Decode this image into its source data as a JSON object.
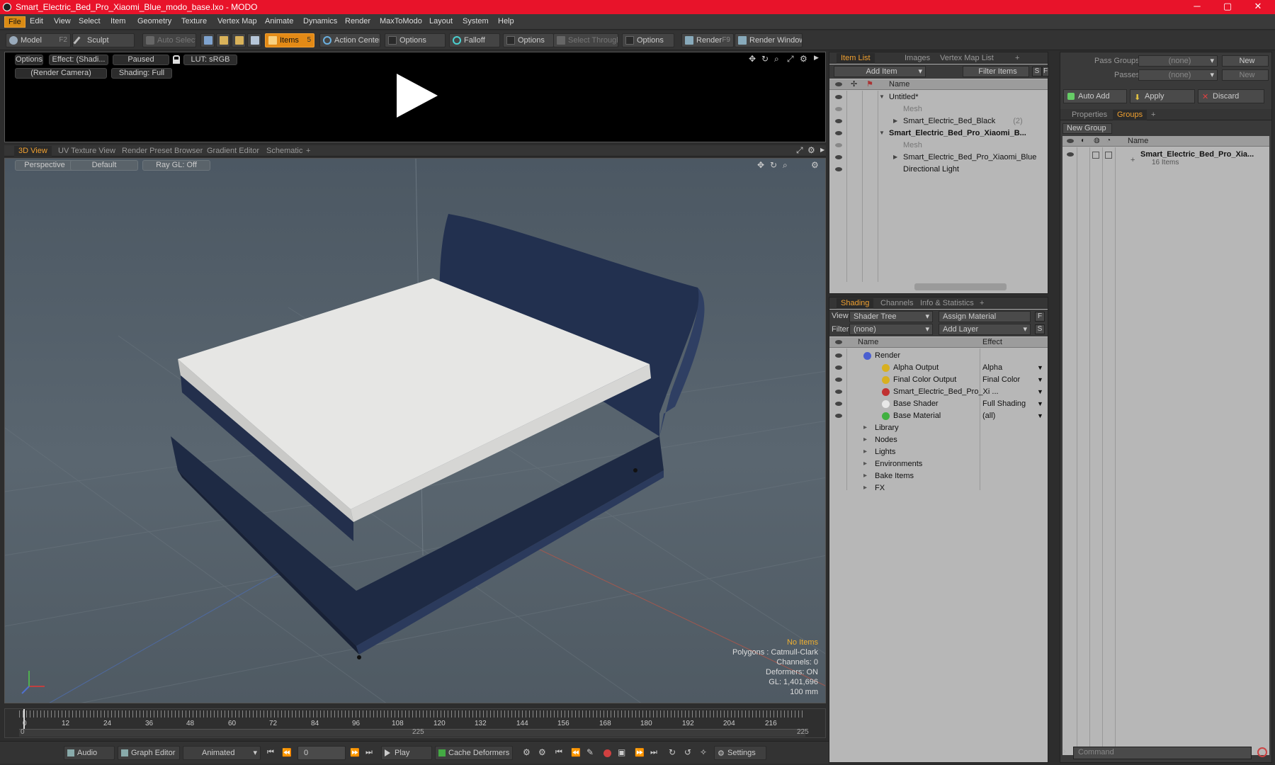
{
  "window": {
    "title": "Smart_Electric_Bed_Pro_Xiaomi_Blue_modo_base.lxo - MODO",
    "minimize": "─",
    "maximize": "▢",
    "close": "✕"
  },
  "menu": [
    "File",
    "Edit",
    "View",
    "Select",
    "Item",
    "Geometry",
    "Texture",
    "Vertex Map",
    "Animate",
    "Dynamics",
    "Render",
    "MaxToModo",
    "Layout",
    "System",
    "Help"
  ],
  "toolbar": {
    "model": "Model",
    "model_key": "F2",
    "sculpt": "Sculpt",
    "auto_select": "Auto Select",
    "items": "Items",
    "items_key": "5",
    "action_center": "Action Center",
    "options1": "Options",
    "falloff": "Falloff",
    "options2": "Options",
    "select_through": "Select Through",
    "options3": "Options",
    "render": "Render",
    "render_key": "F9",
    "render_window": "Render Window"
  },
  "render_preview": {
    "options": "Options",
    "effect": "Effect: (Shadi...",
    "paused": "Paused",
    "lut": "LUT: sRGB",
    "camera": "(Render Camera)",
    "shading": "Shading: Full"
  },
  "viewport_tabs": [
    "3D View",
    "UV Texture View",
    "Render Preset Browser",
    "Gradient Editor",
    "Schematic"
  ],
  "viewport": {
    "perspective": "Perspective",
    "default": "Default",
    "raygl": "Ray GL: Off"
  },
  "viewport_info": {
    "items": "No Items",
    "polygons": "Polygons : Catmull-Clark",
    "channels": "Channels: 0",
    "deformers": "Deformers: ON",
    "gl": "GL: 1,401,696",
    "scale": "100 mm"
  },
  "timeline": {
    "ticks": [
      "0",
      "12",
      "24",
      "36",
      "48",
      "60",
      "72",
      "84",
      "96",
      "108",
      "120",
      "132",
      "144",
      "156",
      "168",
      "180",
      "192",
      "204",
      "216"
    ],
    "start": "0",
    "mid": "225",
    "end": "225"
  },
  "bottom": {
    "audio": "Audio",
    "graph_editor": "Graph Editor",
    "animated": "Animated",
    "frame": "0",
    "play": "Play",
    "cache_deformers": "Cache Deformers",
    "settings": "Settings"
  },
  "item_list": {
    "tabs": [
      "Item List",
      "Images",
      "Vertex Map List"
    ],
    "add_item": "Add Item",
    "filter": "Filter Items",
    "s_btn": "S",
    "f_btn": "F",
    "col_name": "Name",
    "rows": [
      {
        "label": "Untitled*",
        "style": "",
        "indent": 0
      },
      {
        "label": "Mesh",
        "style": "dim",
        "indent": 1
      },
      {
        "label": "Smart_Electric_Bed_Black",
        "count": "(2)",
        "style": "",
        "indent": 1
      },
      {
        "label": "Smart_Electric_Bed_Pro_Xiaomi_B...",
        "style": "bold",
        "indent": 0
      },
      {
        "label": "Mesh",
        "style": "dim",
        "indent": 1
      },
      {
        "label": "Smart_Electric_Bed_Pro_Xiaomi_Blue",
        "count": "(2)",
        "style": "",
        "indent": 1
      },
      {
        "label": "Directional Light",
        "style": "",
        "indent": 1
      }
    ]
  },
  "shading": {
    "tabs": [
      "Shading",
      "Channels",
      "Info & Statistics"
    ],
    "view_label": "View",
    "view_value": "Shader Tree",
    "assign": "Assign Material",
    "filter_label": "Filter",
    "filter_value": "(none)",
    "add_layer": "Add Layer",
    "f_btn": "F",
    "s_btn": "S",
    "col_name": "Name",
    "col_effect": "Effect",
    "rows": [
      {
        "label": "Render",
        "effect": "",
        "indent": 0,
        "icon": "#4a5fd0"
      },
      {
        "label": "Alpha Output",
        "effect": "Alpha",
        "indent": 1,
        "icon": "#d8b020"
      },
      {
        "label": "Final Color Output",
        "effect": "Final Color",
        "indent": 1,
        "icon": "#d8b020"
      },
      {
        "label": "Smart_Electric_Bed_Pro_Xi ...",
        "effect": "",
        "indent": 1,
        "icon": "#c03030"
      },
      {
        "label": "Base Shader",
        "effect": "Full Shading",
        "indent": 1,
        "icon": "#e8e8e8"
      },
      {
        "label": "Base Material",
        "effect": "(all)",
        "indent": 1,
        "icon": "#40b040"
      },
      {
        "label": "Library",
        "effect": "",
        "indent": 0,
        "icon": ""
      },
      {
        "label": "Nodes",
        "effect": "",
        "indent": 0,
        "icon": ""
      },
      {
        "label": "Lights",
        "effect": "",
        "indent": 0,
        "icon": ""
      },
      {
        "label": "Environments",
        "effect": "",
        "indent": 0,
        "icon": ""
      },
      {
        "label": "Bake Items",
        "effect": "",
        "indent": 0,
        "icon": ""
      },
      {
        "label": "FX",
        "effect": "",
        "indent": 0,
        "icon": ""
      }
    ]
  },
  "right": {
    "pass_groups": "Pass Groups",
    "pass_value": "(none)",
    "new1": "New",
    "passes": "Passes",
    "passes_value": "(none)",
    "new2": "New",
    "auto_add": "Auto Add",
    "apply": "Apply",
    "discard": "Discard",
    "tabs": [
      "Properties",
      "Groups"
    ],
    "new_group": "New Group",
    "col_name": "Name",
    "group_name": "Smart_Electric_Bed_Pro_Xia...",
    "group_count": "16 Items"
  },
  "command": {
    "placeholder": "Command"
  },
  "colors": {
    "accent": "#e38a16",
    "title_bar": "#e8132a",
    "bed_frame": "#1e2a44",
    "mattress": "#e6e6e4"
  }
}
